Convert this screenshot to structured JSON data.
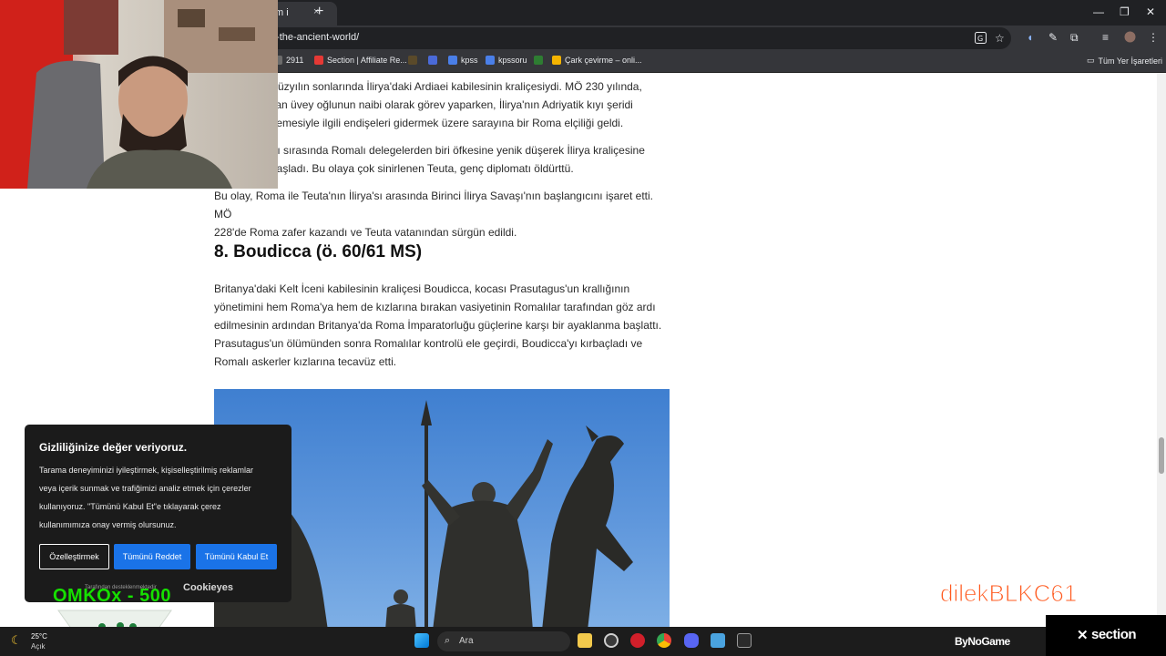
{
  "browser": {
    "tab_title": "m i",
    "tab_close": "×",
    "new_tab": "+",
    "url": "/-the-ancient-world/",
    "window_controls": [
      "—",
      "❐",
      "✕"
    ],
    "bookmarks": [
      {
        "label": "2911",
        "color": "#6b6b6b"
      },
      {
        "label": "Section | Affiliate Re...",
        "color": "#e53935"
      },
      {
        "label": "",
        "color": "#5a4a2a"
      },
      {
        "label": "",
        "color": "#4a6ad8"
      },
      {
        "label": "kpss",
        "color": "#4a7fe8"
      },
      {
        "label": "kpssoru",
        "color": "#4a7fe8"
      },
      {
        "label": "",
        "color": "#2e7d32"
      },
      {
        "label": "Çark çevirme – onli...",
        "color": "#f4b400"
      }
    ],
    "all_bookmarks": "Tüm Yer İşaretleri"
  },
  "article": {
    "p1_lines": [
      "yüzyılın sonlarında İlirya'daki Ardiaei kabilesinin kraliçesiydi. MÖ 230 yılında,",
      "olan üvey oğlunun naibi olarak görev yaparken, İlirya'nın Adriyatik kıyı şeridi",
      "işlemesiyle ilgili endişeleri gidermek üzere sarayına bir Roma elçiliği geldi."
    ],
    "p2_lines": [
      "tı sırasında Romalı delegelerden biri öfkesine yenik düşerek İlirya kraliçesine",
      "başladı. Bu olaya çok sinirlenen Teuta, genç diplomatı öldürttü."
    ],
    "p3_lines": [
      "Bu olay, Roma ile Teuta'nın İlirya'sı arasında Birinci İlirya Savaşı'nın başlangıcını işaret etti. MÖ",
      "228'de Roma zafer kazandı ve Teuta vatanından sürgün edildi."
    ],
    "heading": "8. Boudicca (ö. 60/61 MS)",
    "p4_lines": [
      "Britanya'daki Kelt İceni kabilesinin kraliçesi Boudicca, kocası Prasutagus'un krallığının",
      "yönetimini hem Roma'ya hem de kızlarına bırakan vasiyetinin Romalılar tarafından göz ardı",
      "edilmesinin ardından Britanya'da Roma İmparatorluğu güçlerine karşı bir ayaklanma başlattı.",
      "Prasutagus'un ölümünden sonra Romalılar kontrolü ele geçirdi, Boudicca'yı kırbaçladı ve",
      "Romalı askerler kızlarına tecavüz etti."
    ]
  },
  "cookie": {
    "title": "Gizliliğinize değer veriyoruz.",
    "text": "Tarama deneyiminizi iyileştirmek, kişiselleştirilmiş reklamlar veya içerik sunmak ve trafiğimizi analiz etmek için çerezler kullanıyoruz. \"Tümünü Kabul Et\"e tıklayarak çerez kullanımımıza onay vermiş olursunuz.",
    "customize": "Özelleştirmek",
    "reject_all": "Tümünü Reddet",
    "accept_all": "Tümünü Kabul Et",
    "footer": "Tarafından desteklenmektedir",
    "brand": "Cookieyes"
  },
  "overlays": {
    "goal": "OMKOx - 500",
    "streamer": "dilekBLKC61",
    "section": "section"
  },
  "taskbar": {
    "temp": "25°C",
    "condition": "Açık",
    "search": "Ara",
    "bynogame": "ByNoGame"
  },
  "colors": {
    "accent_blue": "#1a73e8",
    "goal_green": "#16e000",
    "streamer_orange": "#ff5a1f"
  }
}
